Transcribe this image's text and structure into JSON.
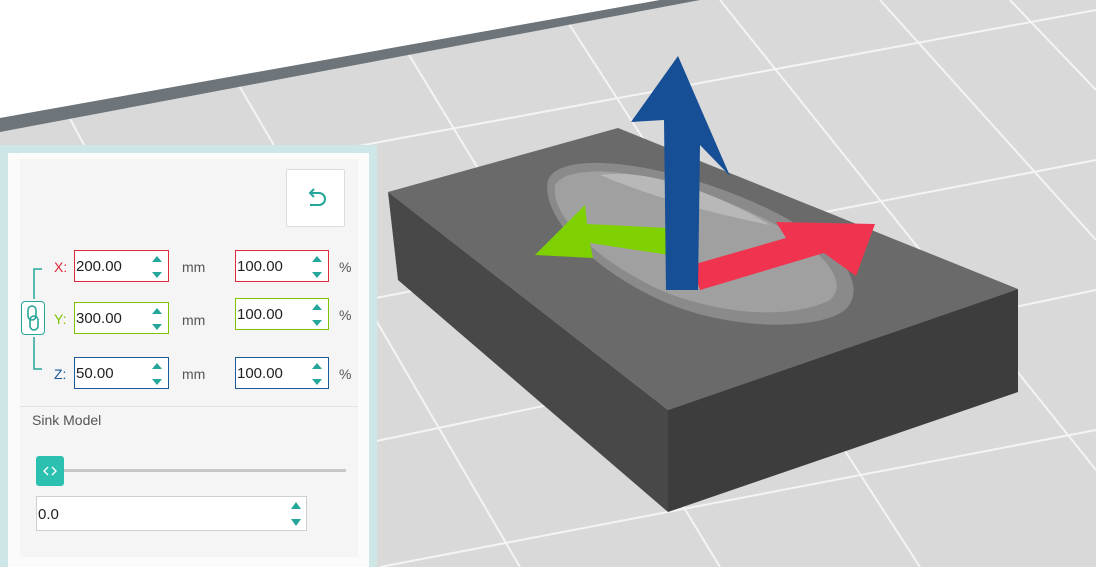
{
  "scene": {
    "background": "#d9d9d9",
    "model_color": "#5a5a5a",
    "gizmo": {
      "x_axis_color": "#f0334f",
      "y_axis_color": "#7fd000",
      "z_axis_color": "#174f96"
    }
  },
  "scale_panel": {
    "reset_icon": "undo-arrow-icon",
    "link_icon": "chain-link-icon",
    "rows": [
      {
        "axis": "X:",
        "size": "200.00",
        "size_unit": "mm",
        "percent": "100.00",
        "percent_unit": "%",
        "color": "#e0283c"
      },
      {
        "axis": "Y:",
        "size": "300.00",
        "size_unit": "mm",
        "percent": "100.00",
        "percent_unit": "%",
        "color": "#7ec200"
      },
      {
        "axis": "Z:",
        "size": "50.00",
        "size_unit": "mm",
        "percent": "100.00",
        "percent_unit": "%",
        "color": "#1a5a96"
      }
    ],
    "sink": {
      "title": "Sink Model",
      "slider_value": 0,
      "value": "0.0"
    }
  }
}
